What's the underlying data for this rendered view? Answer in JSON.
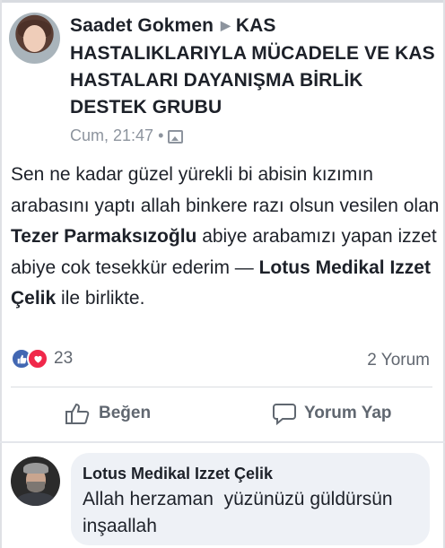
{
  "post": {
    "author": "Saadet Gokmen",
    "group": "KAS HASTALIKLARIYLA MÜCADELE VE KAS HASTALARI DAYANIŞMA BİRLİK DESTEK GRUBU",
    "time": "Cum, 21:47",
    "text_1": "Sen ne kadar güzel yürekli bi abisin kızımın arabasını yaptı allah binkere razı olsun vesilen olan ",
    "mention_1": "Tezer Parmaksızoğlu",
    "text_2": " abiye arabamızı yapan izzet abiye cok tesekkür ederim — ",
    "mention_2": "Lotus Medikal Izzet Çelik",
    "text_3": " ile birlikte."
  },
  "reactions": {
    "count": "23",
    "comments": "2 Yorum"
  },
  "actions": {
    "like_label": "Beğen",
    "comment_label": "Yorum Yap"
  },
  "comment": {
    "author": "Lotus Medikal Izzet Çelik",
    "text": "Allah herzaman  yüzünüzü güldürsün inşaallah"
  },
  "colors": {
    "like_blue": "#4267b2",
    "love_red": "#f0284a",
    "comment_bubble": "#eef1f6"
  }
}
